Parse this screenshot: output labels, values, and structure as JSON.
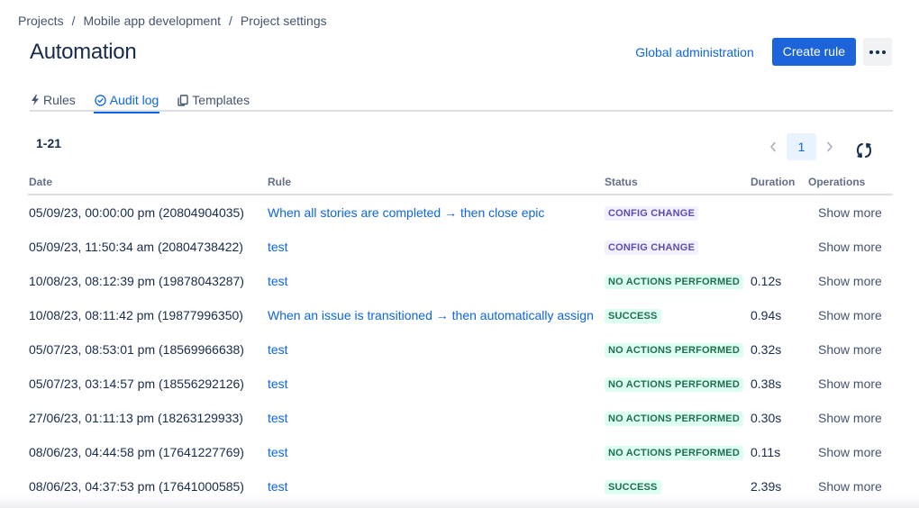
{
  "breadcrumb": [
    "Projects",
    "Mobile app development",
    "Project settings"
  ],
  "breadcrumb_separator": "/",
  "page_title": "Automation",
  "header_actions": {
    "global_admin_label": "Global administration",
    "create_rule_label": "Create rule",
    "more_icon": "more-horizontal-icon"
  },
  "tabs": [
    {
      "label": "Rules",
      "icon": "lightning-icon",
      "active": false
    },
    {
      "label": "Audit log",
      "icon": "check-circle-icon",
      "active": true
    },
    {
      "label": "Templates",
      "icon": "copy-icon",
      "active": false
    }
  ],
  "range_label": "1-21",
  "pagination": {
    "prev_icon": "chevron-left-icon",
    "current_page": "1",
    "next_icon": "chevron-right-icon",
    "refresh_icon": "refresh-icon"
  },
  "table": {
    "columns": [
      "Date",
      "Rule",
      "Status",
      "Duration",
      "Operations"
    ],
    "rows": [
      {
        "date": "05/09/23, 00:00:00 pm (20804904035)",
        "rule": "When all stories are completed → then close epic",
        "status": "CONFIG CHANGE",
        "status_type": "config",
        "duration": "",
        "operation": "Show more"
      },
      {
        "date": "05/09/23, 11:50:34 am (20804738422)",
        "rule": "test",
        "status": "CONFIG CHANGE",
        "status_type": "config",
        "duration": "",
        "operation": "Show more"
      },
      {
        "date": "10/08/23, 08:12:39 pm (19878043287)",
        "rule": "test",
        "status": "NO ACTIONS PERFORMED",
        "status_type": "green",
        "duration": "0.12s",
        "operation": "Show more"
      },
      {
        "date": "10/08/23, 08:11:42 pm (19877996350)",
        "rule": "When an issue is transitioned → then automatically assign",
        "status": "SUCCESS",
        "status_type": "green",
        "duration": "0.94s",
        "operation": "Show more"
      },
      {
        "date": "05/07/23, 08:53:01 pm (18569966638)",
        "rule": "test",
        "status": "NO ACTIONS PERFORMED",
        "status_type": "green",
        "duration": "0.32s",
        "operation": "Show more"
      },
      {
        "date": "05/07/23, 03:14:57 pm (18556292126)",
        "rule": "test",
        "status": "NO ACTIONS PERFORMED",
        "status_type": "green",
        "duration": "0.38s",
        "operation": "Show more"
      },
      {
        "date": "27/06/23, 01:11:13 pm (18263129933)",
        "rule": "test",
        "status": "NO ACTIONS PERFORMED",
        "status_type": "green",
        "duration": "0.30s",
        "operation": "Show more"
      },
      {
        "date": "08/06/23, 04:44:58 pm (17641227769)",
        "rule": "test",
        "status": "NO ACTIONS PERFORMED",
        "status_type": "green",
        "duration": "0.11s",
        "operation": "Show more"
      },
      {
        "date": "08/06/23, 04:37:53 pm (17641000585)",
        "rule": "test",
        "status": "SUCCESS",
        "status_type": "green",
        "duration": "2.39s",
        "operation": "Show more"
      }
    ]
  },
  "colors": {
    "accent": "#0C66E4",
    "primary_button": "#1D63DA",
    "config_lozenge_bg": "#F3F0FF",
    "config_lozenge_text": "#5E4DB2",
    "success_lozenge_bg": "#DCFFF1",
    "success_lozenge_text": "#216E4E"
  }
}
